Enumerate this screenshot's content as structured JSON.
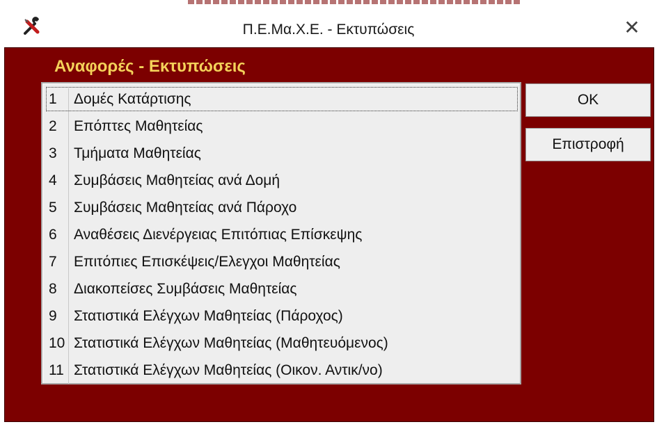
{
  "window": {
    "title": "Π.Ε.Μα.Χ.Ε. - Εκτυπώσεις",
    "app_icon": "tools-icon",
    "close_icon": "close-icon",
    "close_glyph": "✕",
    "frame_color": "#7c0000",
    "heading_color": "#f4d25a"
  },
  "panel": {
    "heading": "Αναφορές - Εκτυπώσεις"
  },
  "reports": [
    {
      "num": "1",
      "label": "Δομές Κατάρτισης"
    },
    {
      "num": "2",
      "label": "Επόπτες Μαθητείας"
    },
    {
      "num": "3",
      "label": "Τμήματα Μαθητείας"
    },
    {
      "num": "4",
      "label": "Συμβάσεις Μαθητείας ανά Δομή"
    },
    {
      "num": "5",
      "label": "Συμβάσεις Μαθητείας ανά Πάροχο"
    },
    {
      "num": "6",
      "label": "Αναθέσεις Διενέργειας Επιτόπιας Επίσκεψης"
    },
    {
      "num": "7",
      "label": "Επιτόπιες Επισκέψεις/Ελεγχοι Μαθητείας"
    },
    {
      "num": "8",
      "label": "Διακοπείσες Συμβάσεις Μαθητείας"
    },
    {
      "num": "9",
      "label": "Στατιστικά Ελέγχων Μαθητείας (Πάροχος)"
    },
    {
      "num": "10",
      "label": "Στατιστικά Ελέγχων Μαθητείας (Μαθητευόμενος)"
    },
    {
      "num": "11",
      "label": "Στατιστικά Ελέγχων Μαθητείας (Οικον. Αντικ/νο)"
    }
  ],
  "selected_report": "1",
  "buttons": {
    "ok": "OK",
    "back": "Επιστροφή"
  }
}
